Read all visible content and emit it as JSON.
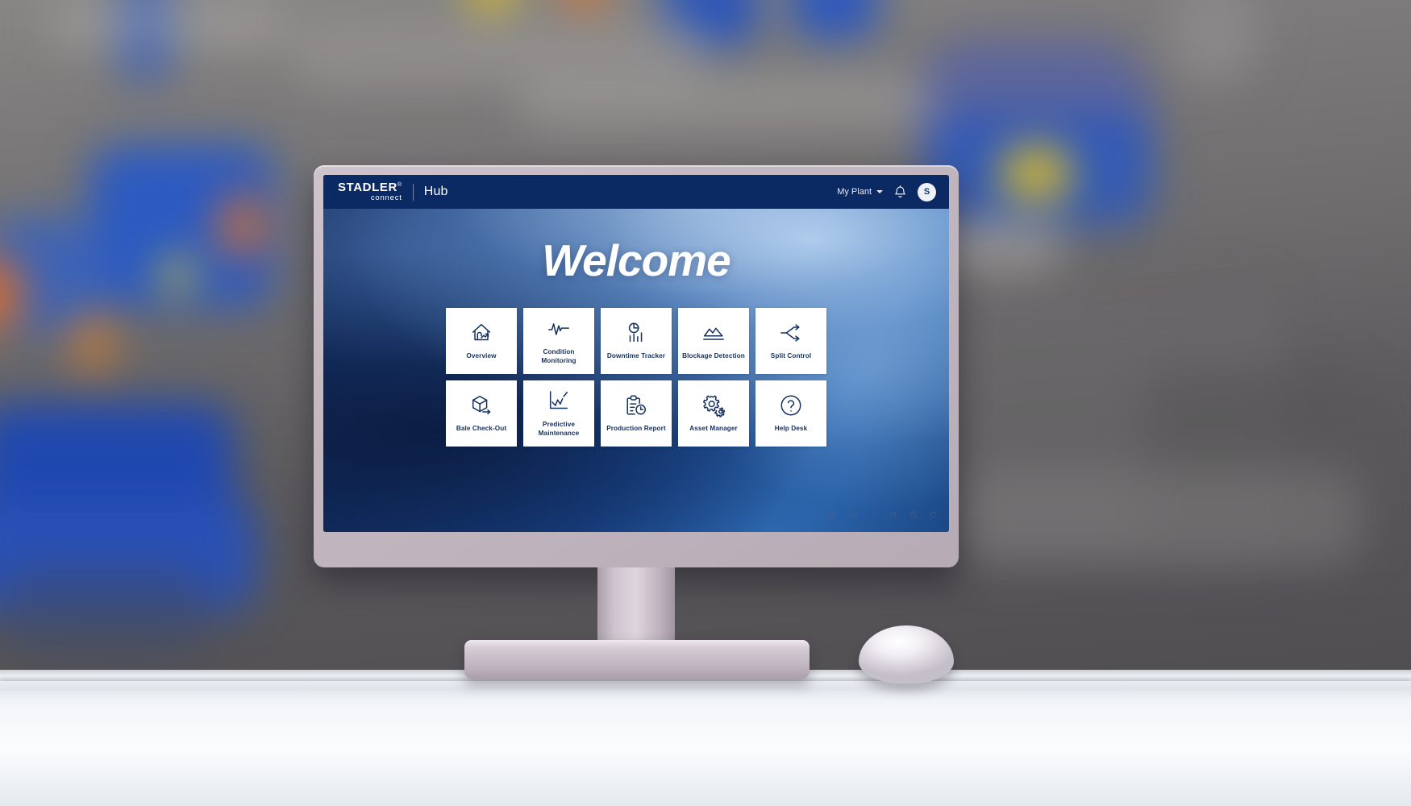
{
  "app": {
    "logo_main": "STADLER",
    "logo_reg": "®",
    "logo_sub": "connect",
    "title": "Hub"
  },
  "header": {
    "plant_label": "My Plant",
    "plant_chevron_icon": "chevron-down-icon",
    "notification_icon": "bell-icon",
    "avatar_initial": "S"
  },
  "main": {
    "welcome": "Welcome",
    "tiles": [
      {
        "label": "Overview",
        "icon": "house-trend-icon"
      },
      {
        "label": "Condition Monitoring",
        "icon": "pulse-icon"
      },
      {
        "label": "Downtime Tracker",
        "icon": "pie-bars-icon"
      },
      {
        "label": "Blockage Detection",
        "icon": "area-chart-icon"
      },
      {
        "label": "Split Control",
        "icon": "split-arrows-icon"
      },
      {
        "label": "Bale Check-Out",
        "icon": "cube-arrow-icon"
      },
      {
        "label": "Predictive Maintenance",
        "icon": "trend-chart-icon"
      },
      {
        "label": "Production Report",
        "icon": "clipboard-clock-icon"
      },
      {
        "label": "Asset Manager",
        "icon": "gears-icon"
      },
      {
        "label": "Help Desk",
        "icon": "question-circle-icon"
      }
    ]
  },
  "bezel": {
    "icons": [
      "home-icon",
      "brightness-icon",
      "info-icon",
      "power-icon",
      "menu-icon",
      "settings-icon"
    ]
  },
  "colors": {
    "brand_navy": "#0b2a63",
    "tile_text": "#14305f",
    "screen_blue": "#1c4b94",
    "bezel": "#c3b7c0"
  }
}
